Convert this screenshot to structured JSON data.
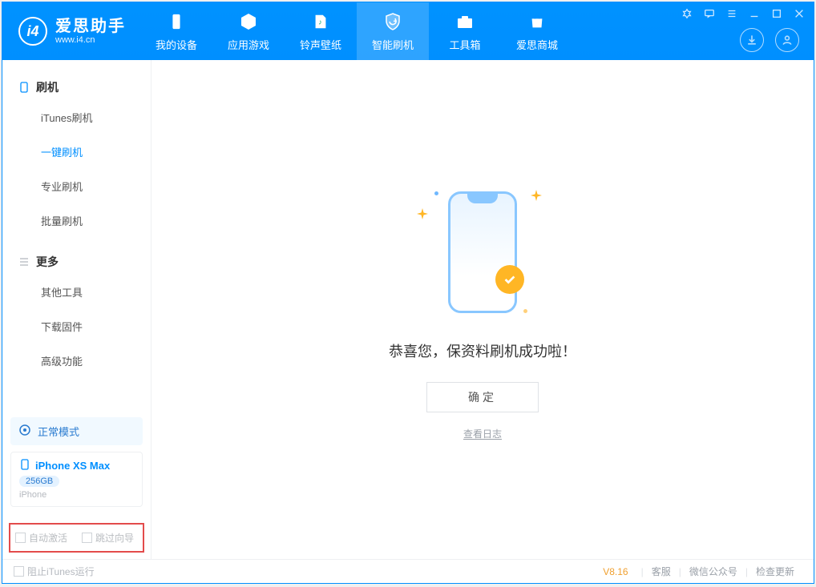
{
  "app": {
    "name_cn": "爱思助手",
    "name_en": "www.i4.cn"
  },
  "tabs": [
    {
      "id": "mydevice",
      "label": "我的设备"
    },
    {
      "id": "apps",
      "label": "应用游戏"
    },
    {
      "id": "rings",
      "label": "铃声壁纸"
    },
    {
      "id": "flash",
      "label": "智能刷机"
    },
    {
      "id": "toolbox",
      "label": "工具箱"
    },
    {
      "id": "store",
      "label": "爱思商城"
    }
  ],
  "sidebar": {
    "section_flash": "刷机",
    "items_flash": [
      {
        "label": "iTunes刷机"
      },
      {
        "label": "一键刷机"
      },
      {
        "label": "专业刷机"
      },
      {
        "label": "批量刷机"
      }
    ],
    "section_more": "更多",
    "items_more": [
      {
        "label": "其他工具"
      },
      {
        "label": "下载固件"
      },
      {
        "label": "高级功能"
      }
    ]
  },
  "device": {
    "mode_label": "正常模式",
    "name": "iPhone XS Max",
    "capacity": "256GB",
    "type": "iPhone"
  },
  "options": {
    "auto_activate": "自动激活",
    "skip_guide": "跳过向导"
  },
  "main": {
    "message": "恭喜您，保资料刷机成功啦！",
    "ok": "确定",
    "view_log": "查看日志"
  },
  "status": {
    "block_itunes": "阻止iTunes运行",
    "version": "V8.16",
    "links": [
      "客服",
      "微信公众号",
      "检查更新"
    ]
  }
}
